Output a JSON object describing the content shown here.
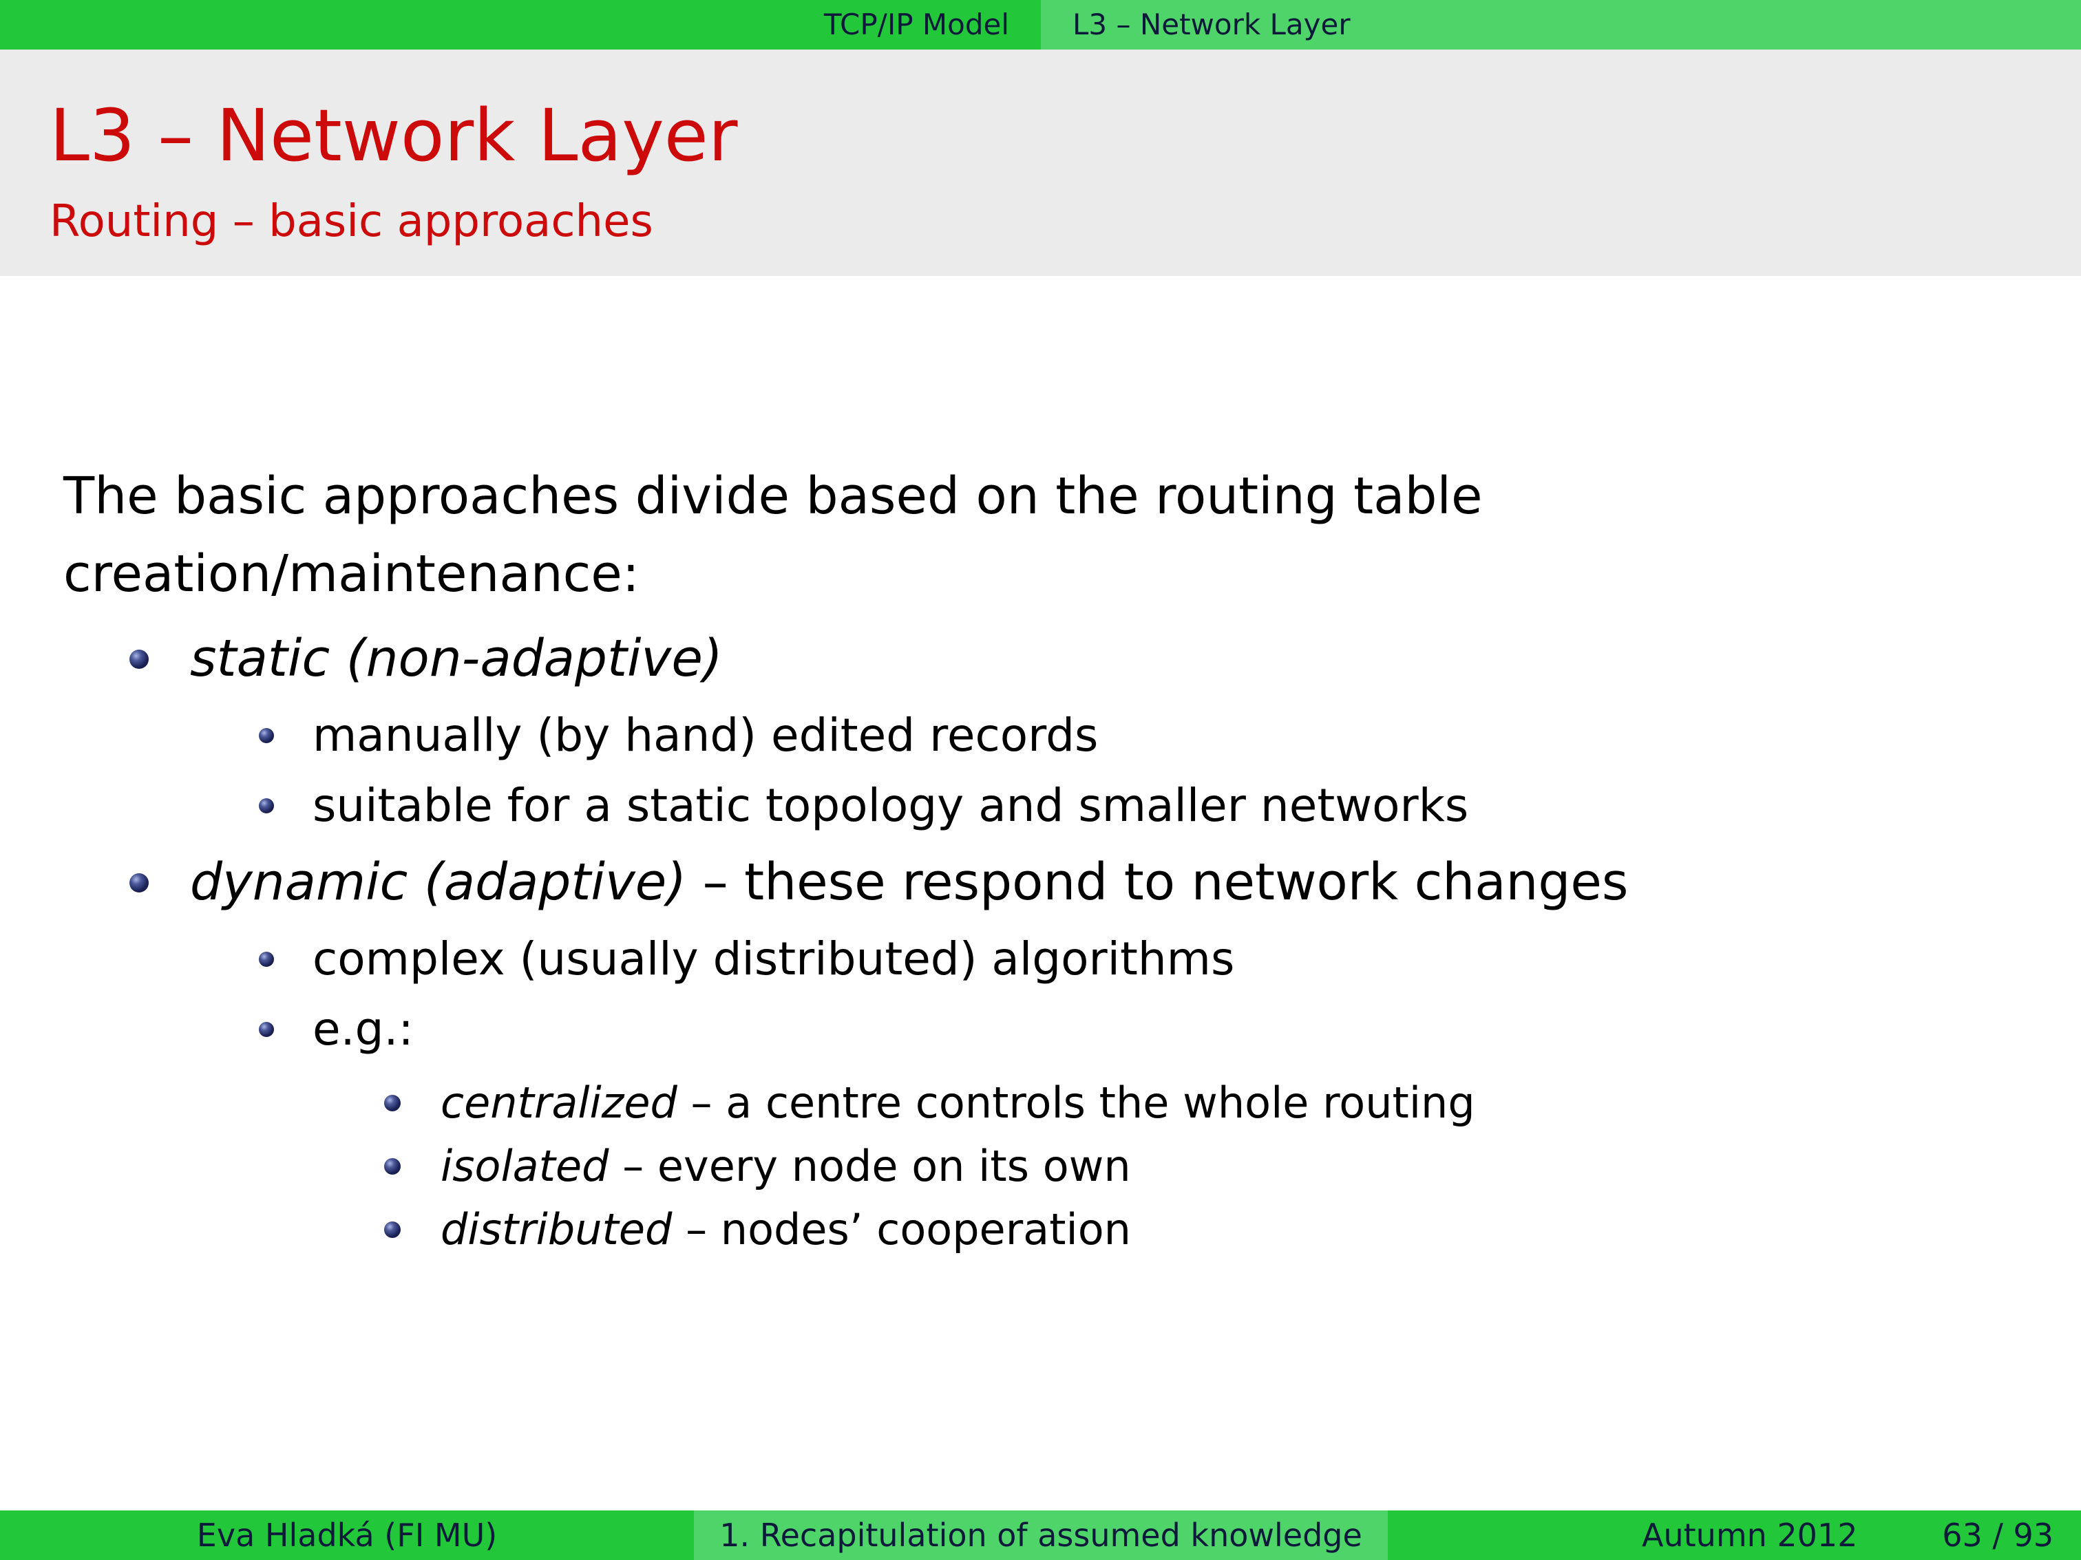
{
  "header": {
    "section": "TCP/IP Model",
    "subsection": "L3 – Network Layer"
  },
  "frame": {
    "title": "L3 – Network Layer",
    "subtitle": "Routing – basic approaches"
  },
  "content": {
    "intro_line1": "The basic approaches divide based on the routing table",
    "intro_line2": "creation/maintenance:",
    "items": [
      {
        "label": "static (non-adaptive)",
        "children": [
          "manually (by hand) edited records",
          "suitable for a static topology and smaller networks"
        ]
      },
      {
        "label": "dynamic (adaptive)",
        "rest": " – these respond to network changes",
        "children": [
          "complex (usually distributed) algorithms",
          "e.g.:"
        ],
        "examples": [
          {
            "term": "centralized",
            "text": " – a centre controls the whole routing"
          },
          {
            "term": "isolated",
            "text": " – every node on its own"
          },
          {
            "term": "distributed",
            "text": " – nodes’ cooperation"
          }
        ]
      }
    ]
  },
  "footer": {
    "author": "Eva Hladká  (FI MU)",
    "short_title": "1. Recapitulation of assumed knowledge",
    "date": "Autumn 2012",
    "page": "63 / 93"
  },
  "colors": {
    "header_dark": "#22c83a",
    "header_light": "#4fd46a",
    "title_red": "#cc0a0a",
    "title_band": "#ebebeb"
  }
}
